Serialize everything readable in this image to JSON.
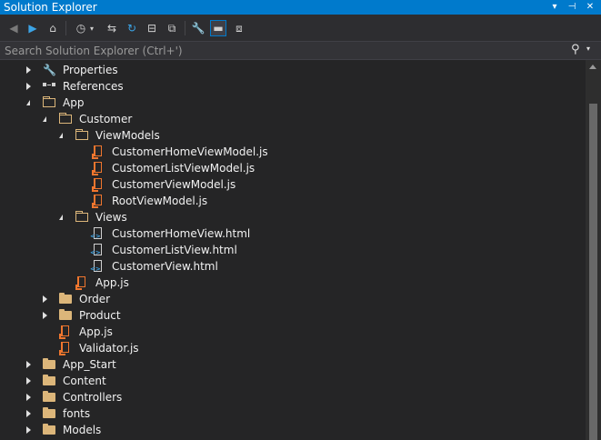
{
  "window": {
    "title": "Solution Explorer",
    "dropdown_glyph": "▾",
    "pin_glyph": "⊣",
    "close_glyph": "✕"
  },
  "toolbar": {
    "back_glyph": "◀",
    "forward_glyph": "▶",
    "home_glyph": "⌂",
    "history_glyph": "◷",
    "history_drop_glyph": "▾",
    "sync_glyph": "⇆",
    "refresh_glyph": "↻",
    "collapse_glyph": "⊟",
    "show_all_glyph": "⧉",
    "properties_glyph": "🔧",
    "preview_glyph": "▬",
    "view_glyph": "⧈"
  },
  "search": {
    "placeholder": "Search Solution Explorer (Ctrl+')",
    "icon_glyph": "⚲",
    "dropdown_glyph": "▾"
  },
  "tree": [
    {
      "label": "Properties",
      "icon": "wrench-icon",
      "toggle": "collapsed",
      "level": 0
    },
    {
      "label": "References",
      "icon": "references-icon",
      "toggle": "collapsed",
      "level": 0
    },
    {
      "label": "App",
      "icon": "folder-open-icon",
      "toggle": "expanded",
      "level": 0
    },
    {
      "label": "Customer",
      "icon": "folder-open-icon",
      "toggle": "expanded",
      "level": 1
    },
    {
      "label": "ViewModels",
      "icon": "folder-open-icon",
      "toggle": "expanded",
      "level": 2
    },
    {
      "label": "CustomerHomeViewModel.js",
      "icon": "js-file-icon",
      "toggle": "none",
      "level": 3
    },
    {
      "label": "CustomerListViewModel.js",
      "icon": "js-file-icon",
      "toggle": "none",
      "level": 3
    },
    {
      "label": "CustomerViewModel.js",
      "icon": "js-file-icon",
      "toggle": "none",
      "level": 3
    },
    {
      "label": "RootViewModel.js",
      "icon": "js-file-icon",
      "toggle": "none",
      "level": 3
    },
    {
      "label": "Views",
      "icon": "folder-open-icon",
      "toggle": "expanded",
      "level": 2
    },
    {
      "label": "CustomerHomeView.html",
      "icon": "html-file-icon",
      "toggle": "none",
      "level": 3
    },
    {
      "label": "CustomerListView.html",
      "icon": "html-file-icon",
      "toggle": "none",
      "level": 3
    },
    {
      "label": "CustomerView.html",
      "icon": "html-file-icon",
      "toggle": "none",
      "level": 3
    },
    {
      "label": "App.js",
      "icon": "js-file-icon",
      "toggle": "none",
      "level": 2
    },
    {
      "label": "Order",
      "icon": "folder-closed-icon",
      "toggle": "collapsed",
      "level": 1
    },
    {
      "label": "Product",
      "icon": "folder-closed-icon",
      "toggle": "collapsed",
      "level": 1
    },
    {
      "label": "App.js",
      "icon": "js-file-icon",
      "toggle": "none",
      "level": 1
    },
    {
      "label": "Validator.js",
      "icon": "js-file-icon",
      "toggle": "none",
      "level": 1
    },
    {
      "label": "App_Start",
      "icon": "folder-closed-icon",
      "toggle": "collapsed",
      "level": 0
    },
    {
      "label": "Content",
      "icon": "folder-closed-icon",
      "toggle": "collapsed",
      "level": 0
    },
    {
      "label": "Controllers",
      "icon": "folder-closed-icon",
      "toggle": "collapsed",
      "level": 0
    },
    {
      "label": "fonts",
      "icon": "folder-closed-icon",
      "toggle": "collapsed",
      "level": 0
    },
    {
      "label": "Models",
      "icon": "folder-closed-icon",
      "toggle": "collapsed",
      "level": 0
    }
  ],
  "colors": {
    "accent": "#007acc",
    "background": "#252526",
    "folder": "#dcb67a",
    "js_file": "#f0762e",
    "text": "#f1f1f1"
  }
}
